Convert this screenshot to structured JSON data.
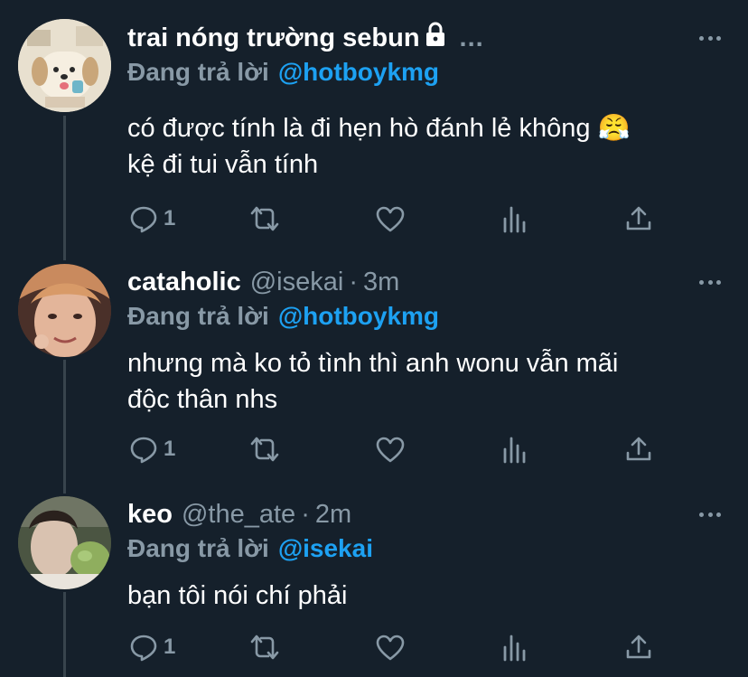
{
  "tweets": [
    {
      "display_name": "trai nóng trường sebun",
      "handle": "",
      "time": "",
      "locked": true,
      "more_inline": "...",
      "reply_prefix": "Đang trả lời",
      "reply_to": "@hotboykmg",
      "text_line1": "có được tính là đi hẹn hò đánh lẻ không 😤",
      "text_line2": "kệ đi tui vẫn tính",
      "reply_count": "1"
    },
    {
      "display_name": "cataholic",
      "handle": "@isekai",
      "sep": "·",
      "time": "3m",
      "reply_prefix": "Đang trả lời",
      "reply_to": "@hotboykmg",
      "text_line1": "nhưng mà ko tỏ tình thì anh wonu vẫn mãi",
      "text_line2": "độc thân nhs",
      "reply_count": "1"
    },
    {
      "display_name": "keo",
      "handle": "@the_ate",
      "sep": "·",
      "time": "2m",
      "reply_prefix": "Đang trả lời",
      "reply_to": "@isekai",
      "text_line1": "bạn tôi nói chí phải",
      "reply_count": "1"
    }
  ],
  "icons": {
    "reply": "reply-icon",
    "retweet": "retweet-icon",
    "like": "like-icon",
    "analytics": "analytics-icon",
    "share": "share-icon",
    "more": "more-icon",
    "lock": "lock-icon"
  },
  "colors": {
    "background": "#15202b",
    "secondary_text": "#8899a6",
    "accent": "#1da1f2",
    "thread_line": "#38444d"
  }
}
